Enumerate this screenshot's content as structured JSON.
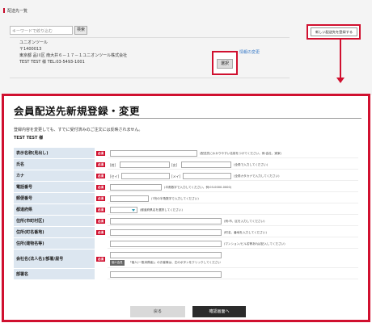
{
  "top": {
    "list_title": "配送先一覧",
    "search_placeholder": "キーワードで絞り込む",
    "search_button": "検索",
    "address": {
      "name": "ユニオンツール",
      "postal": "〒1400013",
      "street": "東京都 品川区 南大井６－１７－１ユニオンツール株式会社",
      "contact": "TEST TEST 様 TEL:03-5493-1001"
    },
    "edit_link": "情報の変更",
    "select_button": "選択",
    "new_register_button": "新しい配送先を登録する"
  },
  "form": {
    "title": "会員配送先新規登録・変更",
    "note": "登録内容を変更しても、すでに受付済みのご注文には反映されません。",
    "user": "TEST TEST 様",
    "required_label": "必須",
    "rows": [
      {
        "label": "表示名称(見出し)",
        "hint": "(配送先にわかりやすい名前をつけてください。例:会社、実家)"
      },
      {
        "label": "氏名",
        "b1": "[姓]",
        "b2": "[名]",
        "hint": "(全角で入力してください)"
      },
      {
        "label": "カナ",
        "b1": "[セイ]",
        "b2": "[メイ]",
        "hint": "(全角カタカナで入力してください)"
      },
      {
        "label": "電話番号",
        "hint": "(半角数字で入力してください。例:03-0000-0000)"
      },
      {
        "label": "郵便番号",
        "hint": "(7桁の半角数字で入力してください)"
      },
      {
        "label": "都道府県",
        "hint": "(都道府県名を選択してください)"
      },
      {
        "label": "住所(市町村区)",
        "hint": "(例:市、区を入力してください)"
      },
      {
        "label": "住所(町名番地)",
        "hint": "(町名、番地を入力してください)"
      },
      {
        "label": "住所(建物名等)",
        "hint": "(マンション/ビル名等あれば記入してください)"
      },
      {
        "label": "会社名(法人名)/部署/屋号",
        "button": "個人会員",
        "hint": "「個人(一般消費者)」のお客様は、左のボタンをクリックしてください"
      },
      {
        "label": "部署名"
      }
    ],
    "back_button": "戻る",
    "confirm_button": "確認画面へ"
  },
  "colors": {
    "accent": "#d0102f",
    "label_bg": "#dce6f0",
    "dark_button": "#2b2b2b"
  }
}
